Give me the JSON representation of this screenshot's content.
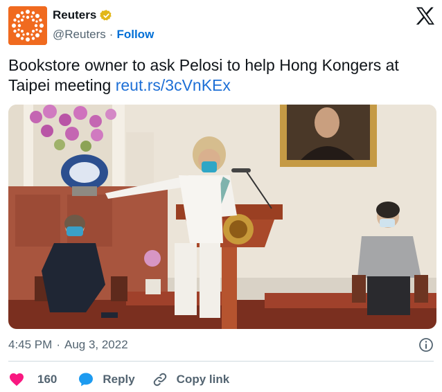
{
  "author": {
    "display_name": "Reuters",
    "handle": "@Reuters",
    "separator": "·",
    "follow_label": "Follow"
  },
  "tweet": {
    "text": "Bookstore owner to ask Pelosi to help Hong Kongers at Taipei meeting ",
    "link": "reut.rs/3cVnKEx"
  },
  "meta": {
    "time": "4:45 PM",
    "separator": "·",
    "date": "Aug 3, 2022"
  },
  "actions": {
    "likes_count": "160",
    "reply_label": "Reply",
    "copy_link_label": "Copy link"
  },
  "colors": {
    "brand_orange": "#f06a1f",
    "verified_gold": "#e2b719",
    "link_blue": "#1d6fd6",
    "like_pink": "#f91880",
    "reply_blue": "#1d9bf0",
    "secondary_text": "#536471"
  },
  "icons": {
    "avatar": "reuters-logo-icon",
    "verified": "verified-badge-icon",
    "platform": "x-logo-icon",
    "info": "info-icon",
    "like": "heart-icon",
    "reply": "speech-bubble-icon",
    "copy": "link-icon"
  }
}
